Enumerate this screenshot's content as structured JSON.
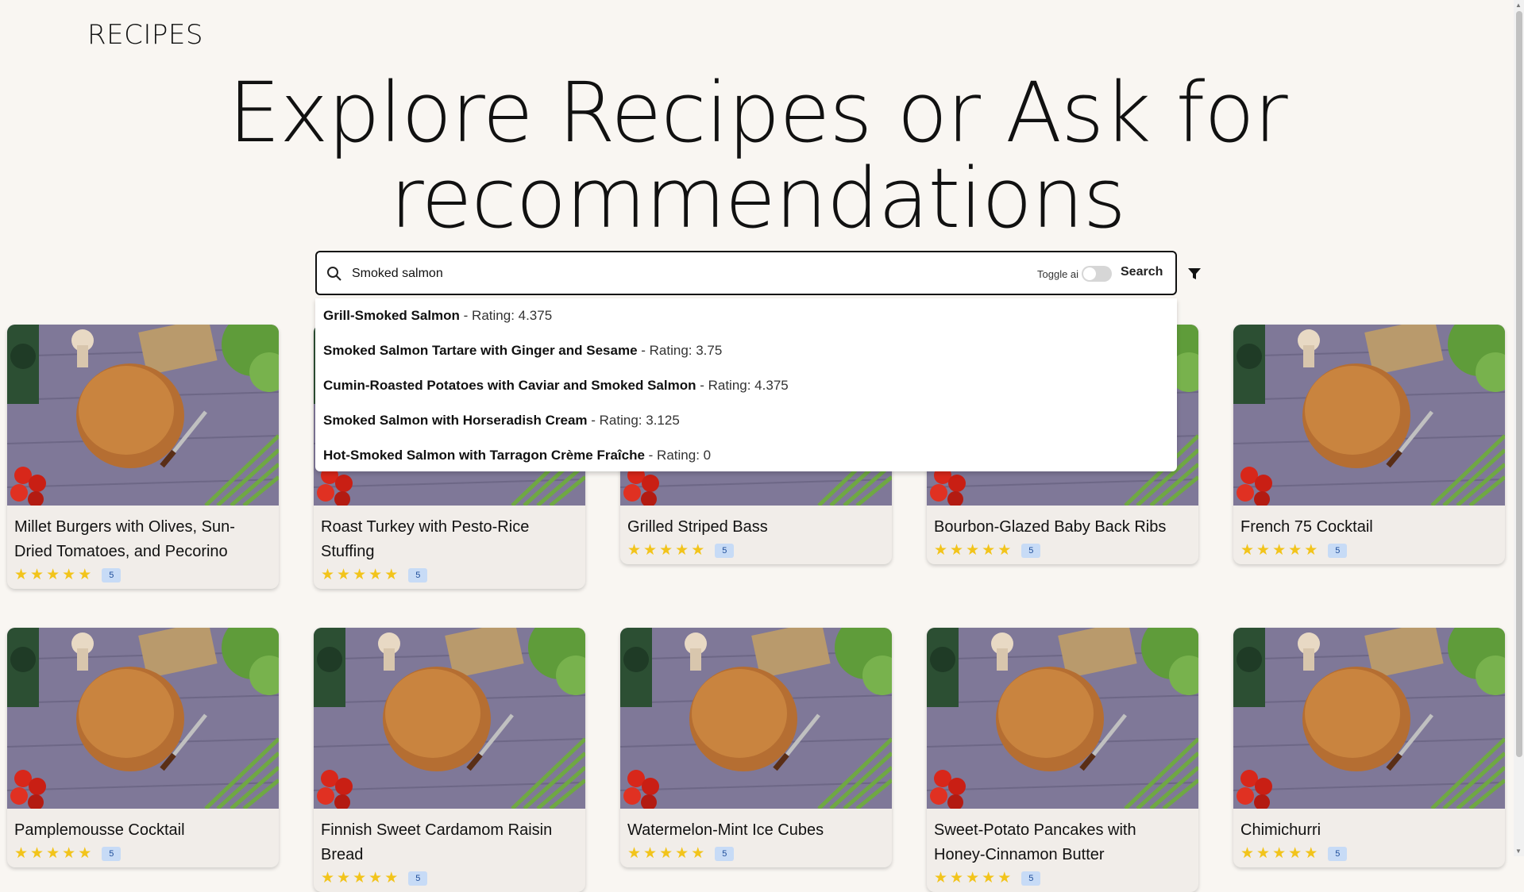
{
  "header": {
    "brand": "RECIPES"
  },
  "hero": {
    "title": "Explore Recipes or Ask for recommendations"
  },
  "search": {
    "value": "Smoked salmon",
    "toggle_label": "Toggle ai",
    "toggle_on": false,
    "button_label": "Search"
  },
  "suggestions": [
    {
      "name": "Grill-Smoked Salmon",
      "rating_text": "Rating: 4.375"
    },
    {
      "name": "Smoked Salmon Tartare with Ginger and Sesame",
      "rating_text": "Rating: 3.75"
    },
    {
      "name": "Cumin-Roasted Potatoes with Caviar and Smoked Salmon",
      "rating_text": "Rating: 4.375"
    },
    {
      "name": "Smoked Salmon with Horseradish Cream",
      "rating_text": "Rating: 3.125"
    },
    {
      "name": "Hot-Smoked Salmon with Tarragon Crème Fraîche",
      "rating_text": "Rating: 0"
    }
  ],
  "cards": [
    {
      "title": "Millet Burgers with Olives, Sun-Dried Tomatoes, and Pecorino",
      "stars": 5,
      "rating": "5"
    },
    {
      "title": "Roast Turkey with Pesto-Rice Stuffing",
      "stars": 5,
      "rating": "5"
    },
    {
      "title": "Grilled Striped Bass",
      "stars": 5,
      "rating": "5"
    },
    {
      "title": "Bourbon-Glazed Baby Back Ribs",
      "stars": 5,
      "rating": "5"
    },
    {
      "title": "French 75 Cocktail",
      "stars": 5,
      "rating": "5"
    },
    {
      "title": "Pamplemousse Cocktail",
      "stars": 5,
      "rating": "5"
    },
    {
      "title": "Finnish Sweet Cardamom Raisin Bread",
      "stars": 5,
      "rating": "5"
    },
    {
      "title": "Watermelon-Mint Ice Cubes",
      "stars": 5,
      "rating": "5"
    },
    {
      "title": "Sweet-Potato Pancakes with Honey-Cinnamon Butter",
      "stars": 5,
      "rating": "5"
    },
    {
      "title": "Chimichurri",
      "stars": 5,
      "rating": "5"
    }
  ],
  "colors": {
    "background": "#f9f6f2",
    "star": "#f2c41b",
    "badge_bg": "#c7dbf6",
    "badge_text": "#1f4e9a"
  }
}
